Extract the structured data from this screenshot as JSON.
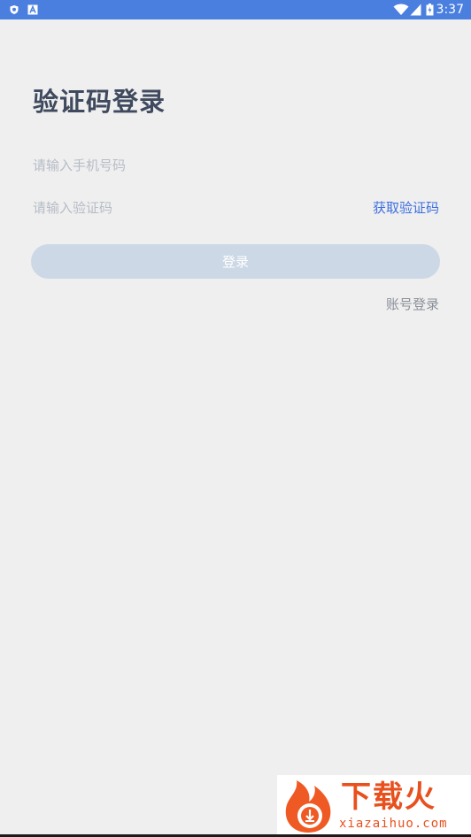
{
  "status_bar": {
    "time": "3:37",
    "left_icons": [
      "shield-icon",
      "a-icon"
    ],
    "right_icons": [
      "wifi-icon",
      "signal-icon",
      "battery-icon"
    ],
    "background": "#4a7fe0"
  },
  "title": "验证码登录",
  "phone": {
    "placeholder": "请输入手机号码",
    "value": ""
  },
  "code": {
    "placeholder": "请输入验证码",
    "value": "",
    "get_code_label": "获取验证码"
  },
  "login_button_label": "登录",
  "account_login_label": "账号登录",
  "watermark": {
    "title": "下载火",
    "url": "xiazaihuo.com"
  },
  "colors": {
    "accent": "#3d6fe0",
    "button_disabled": "#cdd8e6",
    "title": "#3f4a5e",
    "background": "#efefef"
  }
}
